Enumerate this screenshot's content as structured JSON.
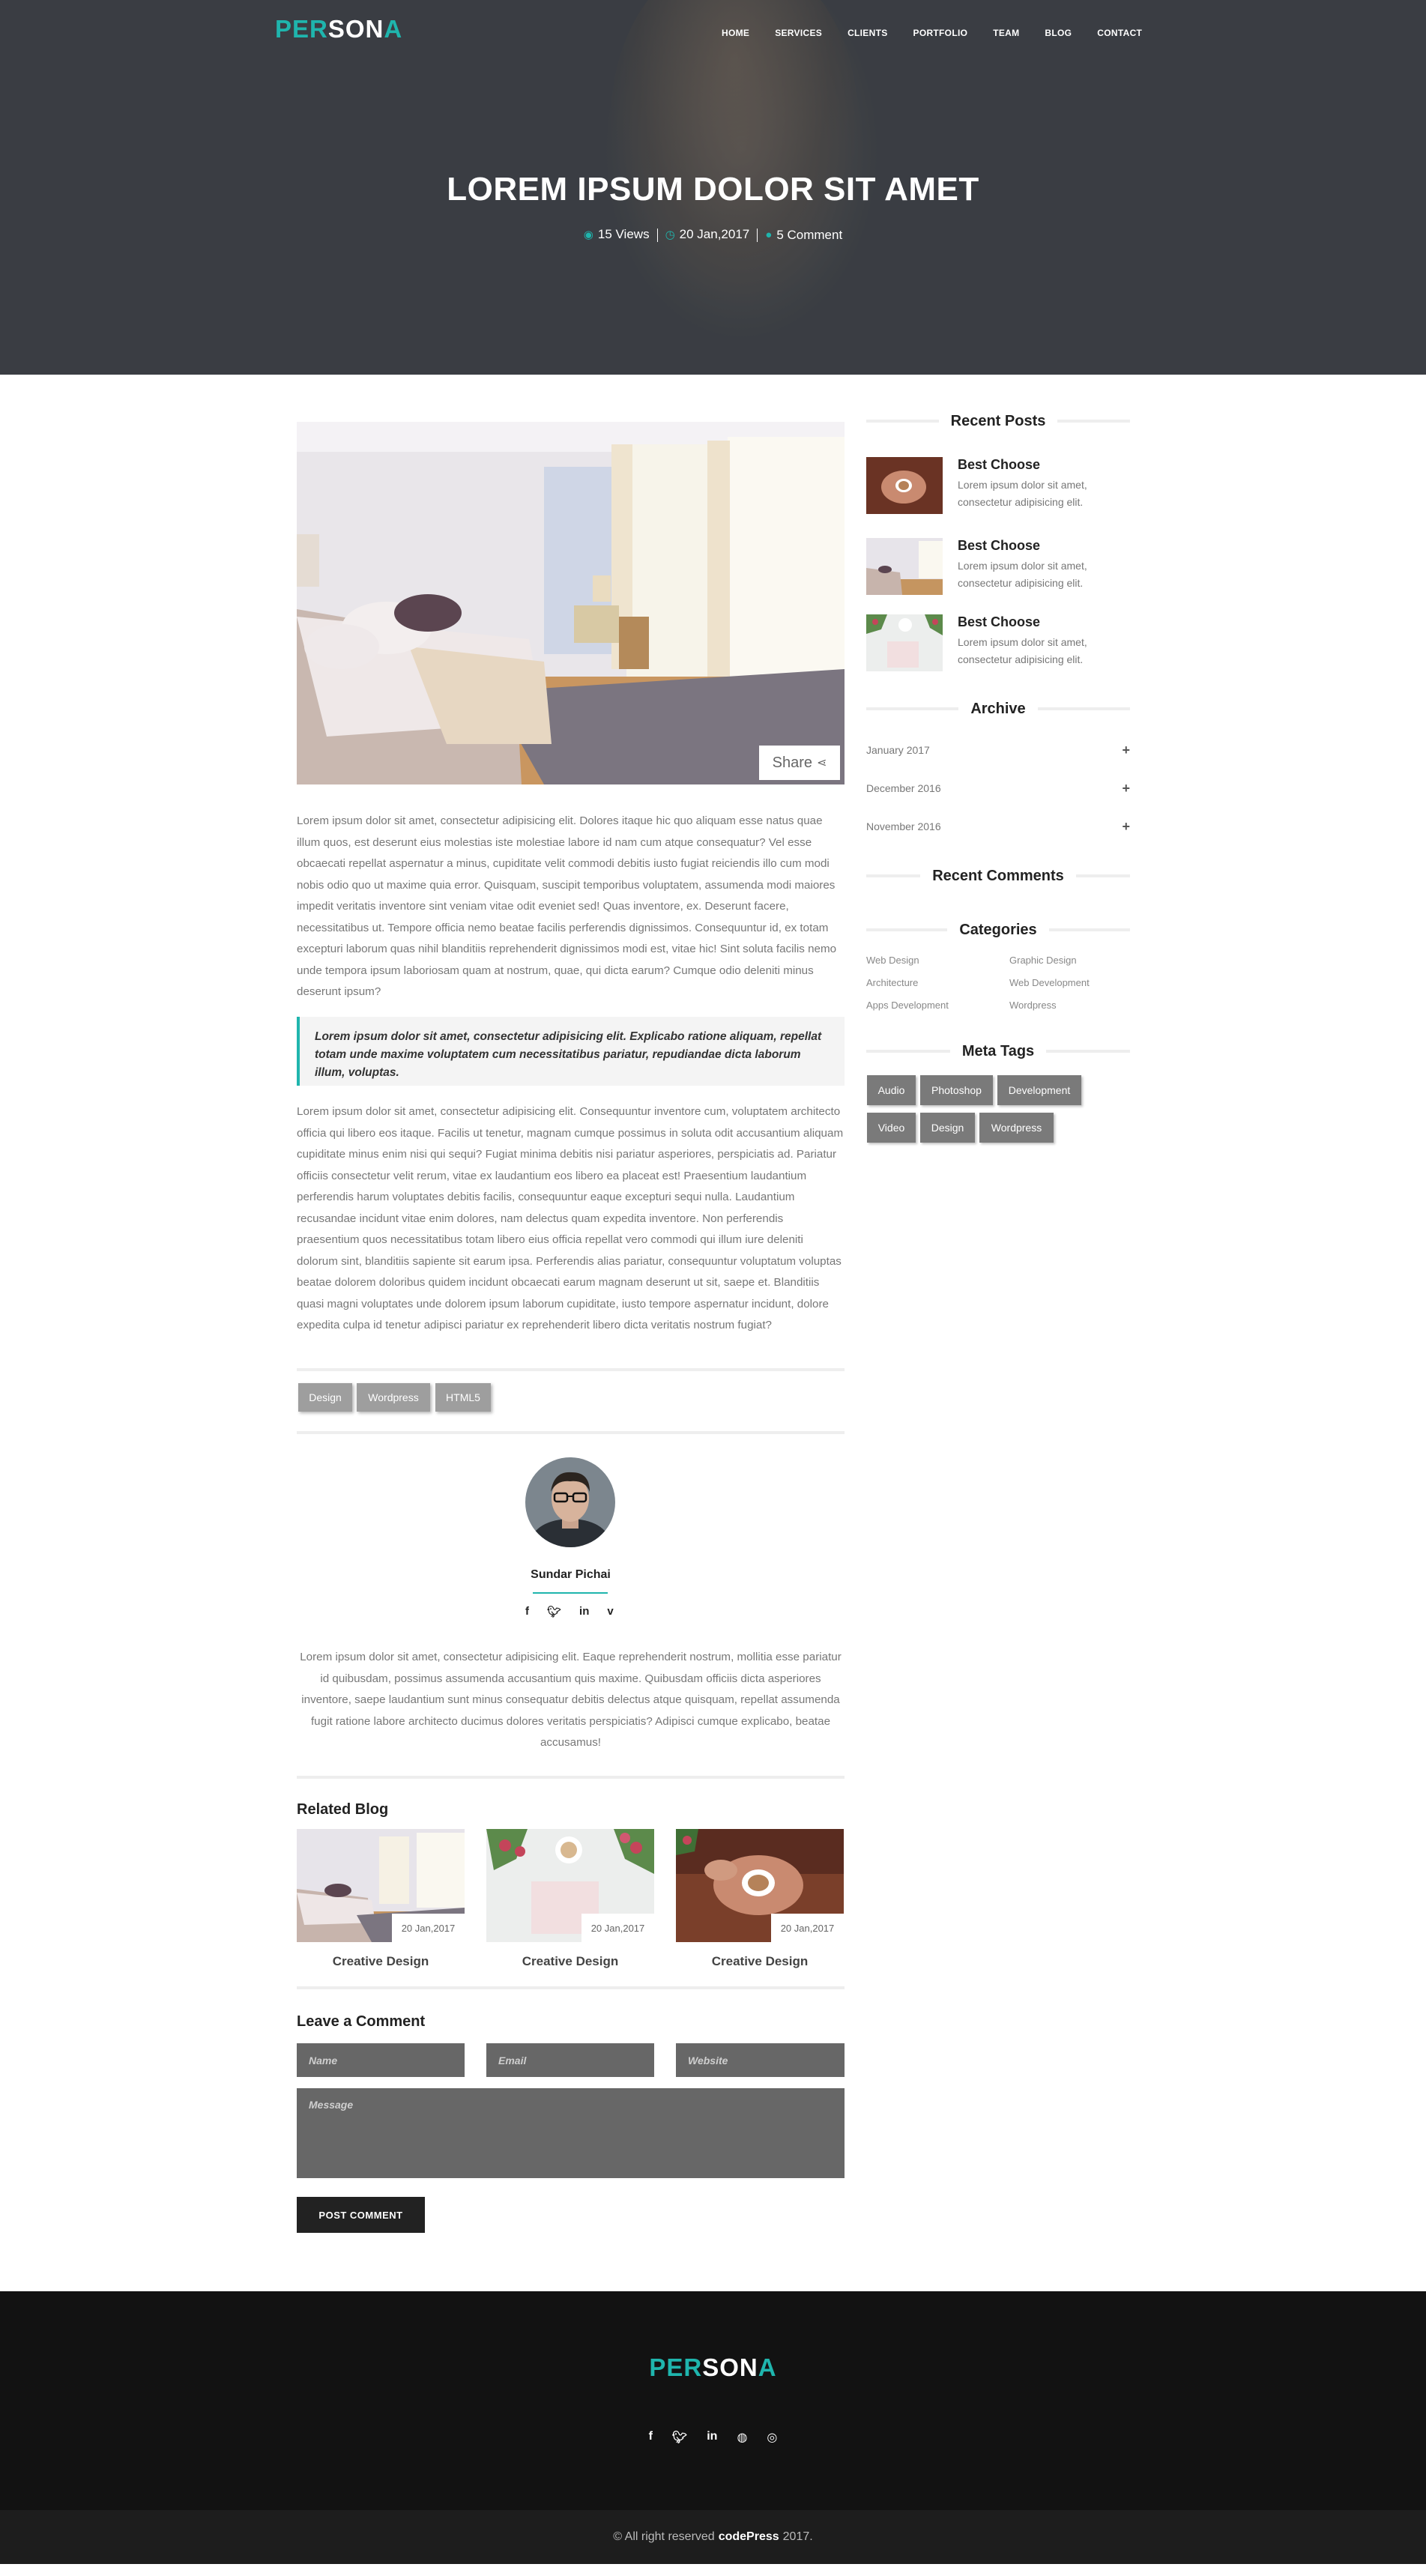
{
  "brand": {
    "logo_part1": "PER",
    "logo_part2": "SON",
    "logo_part3": "A",
    "accent": "#1fb5ad"
  },
  "nav": {
    "items": [
      "HOME",
      "SERVICES",
      "CLIENTS",
      "PORTFOLIO",
      "TEAM",
      "BLOG",
      "CONTACT"
    ]
  },
  "hero": {
    "title": "LOREM IPSUM DOLOR SIT AMET",
    "views": "15 Views",
    "date": "20 Jan,2017",
    "comments": "5 Comment"
  },
  "article": {
    "share_label": "Share",
    "para1": "Lorem ipsum dolor sit amet, consectetur adipisicing elit. Dolores itaque hic quo aliquam esse natus quae illum quos, est deserunt eius molestias iste molestiae labore id nam cum atque consequatur? Vel esse obcaecati repellat aspernatur a minus, cupiditate velit commodi debitis iusto fugiat reiciendis illo cum modi nobis odio quo ut maxime quia error. Quisquam, suscipit temporibus voluptatem, assumenda modi maiores impedit veritatis inventore sint veniam vitae odit eveniet sed! Quas inventore, ex. Deserunt facere, necessitatibus ut. Tempore officia nemo beatae facilis perferendis dignissimos. Consequuntur id, ex totam excepturi laborum quas nihil blanditiis reprehenderit dignissimos modi est, vitae hic! Sint soluta facilis nemo unde tempora ipsum laboriosam quam at nostrum, quae, qui dicta earum? Cumque odio deleniti minus deserunt ipsum?",
    "quote": "Lorem ipsum dolor sit amet, consectetur adipisicing elit. Explicabo ratione aliquam, repellat totam unde maxime voluptatem cum necessitatibus pariatur, repudiandae dicta laborum illum, voluptas.",
    "para2": "Lorem ipsum dolor sit amet, consectetur adipisicing elit. Consequuntur inventore cum, voluptatem architecto officia qui libero eos itaque. Facilis ut tenetur, magnam cumque possimus in soluta odit accusantium aliquam cupiditate minus enim nisi qui sequi? Fugiat minima debitis nisi pariatur asperiores, perspiciatis ad. Pariatur officiis consectetur velit rerum, vitae ex laudantium eos libero ea placeat est! Praesentium laudantium perferendis harum voluptates debitis facilis, consequuntur eaque excepturi sequi nulla. Laudantium recusandae incidunt vitae enim dolores, nam delectus quam expedita inventore. Non perferendis praesentium quos necessitatibus totam libero eius officia repellat vero commodi qui illum iure deleniti dolorum sint, blanditiis sapiente sit earum ipsa. Perferendis alias pariatur, consequuntur voluptatum voluptas beatae dolorem doloribus quidem incidunt obcaecati earum magnam deserunt ut sit, saepe et. Blanditiis quasi magni voluptates unde dolorem ipsum laborum cupiditate, iusto tempore aspernatur incidunt, dolore expedita culpa id tenetur adipisci pariatur ex reprehenderit libero dicta veritatis nostrum fugiat?",
    "tags": [
      "Design",
      "Wordpress",
      "HTML5"
    ]
  },
  "author": {
    "name": "Sundar Pichai",
    "social": [
      "facebook-icon",
      "twitter-icon",
      "linkedin-icon",
      "vimeo-icon"
    ],
    "bio": "Lorem ipsum dolor sit amet, consectetur adipisicing elit. Eaque reprehenderit nostrum, mollitia esse pariatur id quibusdam, possimus assumenda accusantium quis maxime. Quibusdam officiis dicta asperiores inventore, saepe laudantium sunt minus consequatur debitis delectus atque quisquam, repellat assumenda fugit ratione labore architecto ducimus dolores veritatis perspiciatis? Adipisci cumque explicabo, beatae accusamus!"
  },
  "related": {
    "heading": "Related Blog",
    "items": [
      {
        "date": "20 Jan,2017",
        "title": "Creative Design"
      },
      {
        "date": "20 Jan,2017",
        "title": "Creative Design"
      },
      {
        "date": "20 Jan,2017",
        "title": "Creative Design"
      }
    ]
  },
  "comment_form": {
    "heading": "Leave a Comment",
    "name_placeholder": "Name",
    "email_placeholder": "Email",
    "website_placeholder": "Website",
    "message_placeholder": "Message",
    "submit_label": "POST COMMENT"
  },
  "sidebar": {
    "recent_posts_title": "Recent Posts",
    "recent_posts": [
      {
        "title": "Best Choose",
        "excerpt": "Lorem ipsum dolor sit amet, consectetur adipisicing elit."
      },
      {
        "title": "Best Choose",
        "excerpt": "Lorem ipsum dolor sit amet, consectetur adipisicing elit."
      },
      {
        "title": "Best Choose",
        "excerpt": "Lorem ipsum dolor sit amet, consectetur adipisicing elit."
      }
    ],
    "archive_title": "Archive",
    "archive": [
      "January 2017",
      "December 2016",
      "November 2016"
    ],
    "recent_comments_title": "Recent Comments",
    "categories_title": "Categories",
    "categories": [
      "Web Design",
      "Graphic Design",
      "Architecture",
      "Web Development",
      "Apps Development",
      "Wordpress"
    ],
    "meta_tags_title": "Meta Tags",
    "meta_tags": [
      "Audio",
      "Photoshop",
      "Development",
      "Video",
      "Design",
      "Wordpress"
    ]
  },
  "footer": {
    "social": [
      "facebook-icon",
      "twitter-icon",
      "linkedin-icon",
      "github-icon",
      "dribbble-icon"
    ],
    "copy_prefix": "© All right reserved",
    "copy_brand": "codePress",
    "copy_year": "2017."
  }
}
